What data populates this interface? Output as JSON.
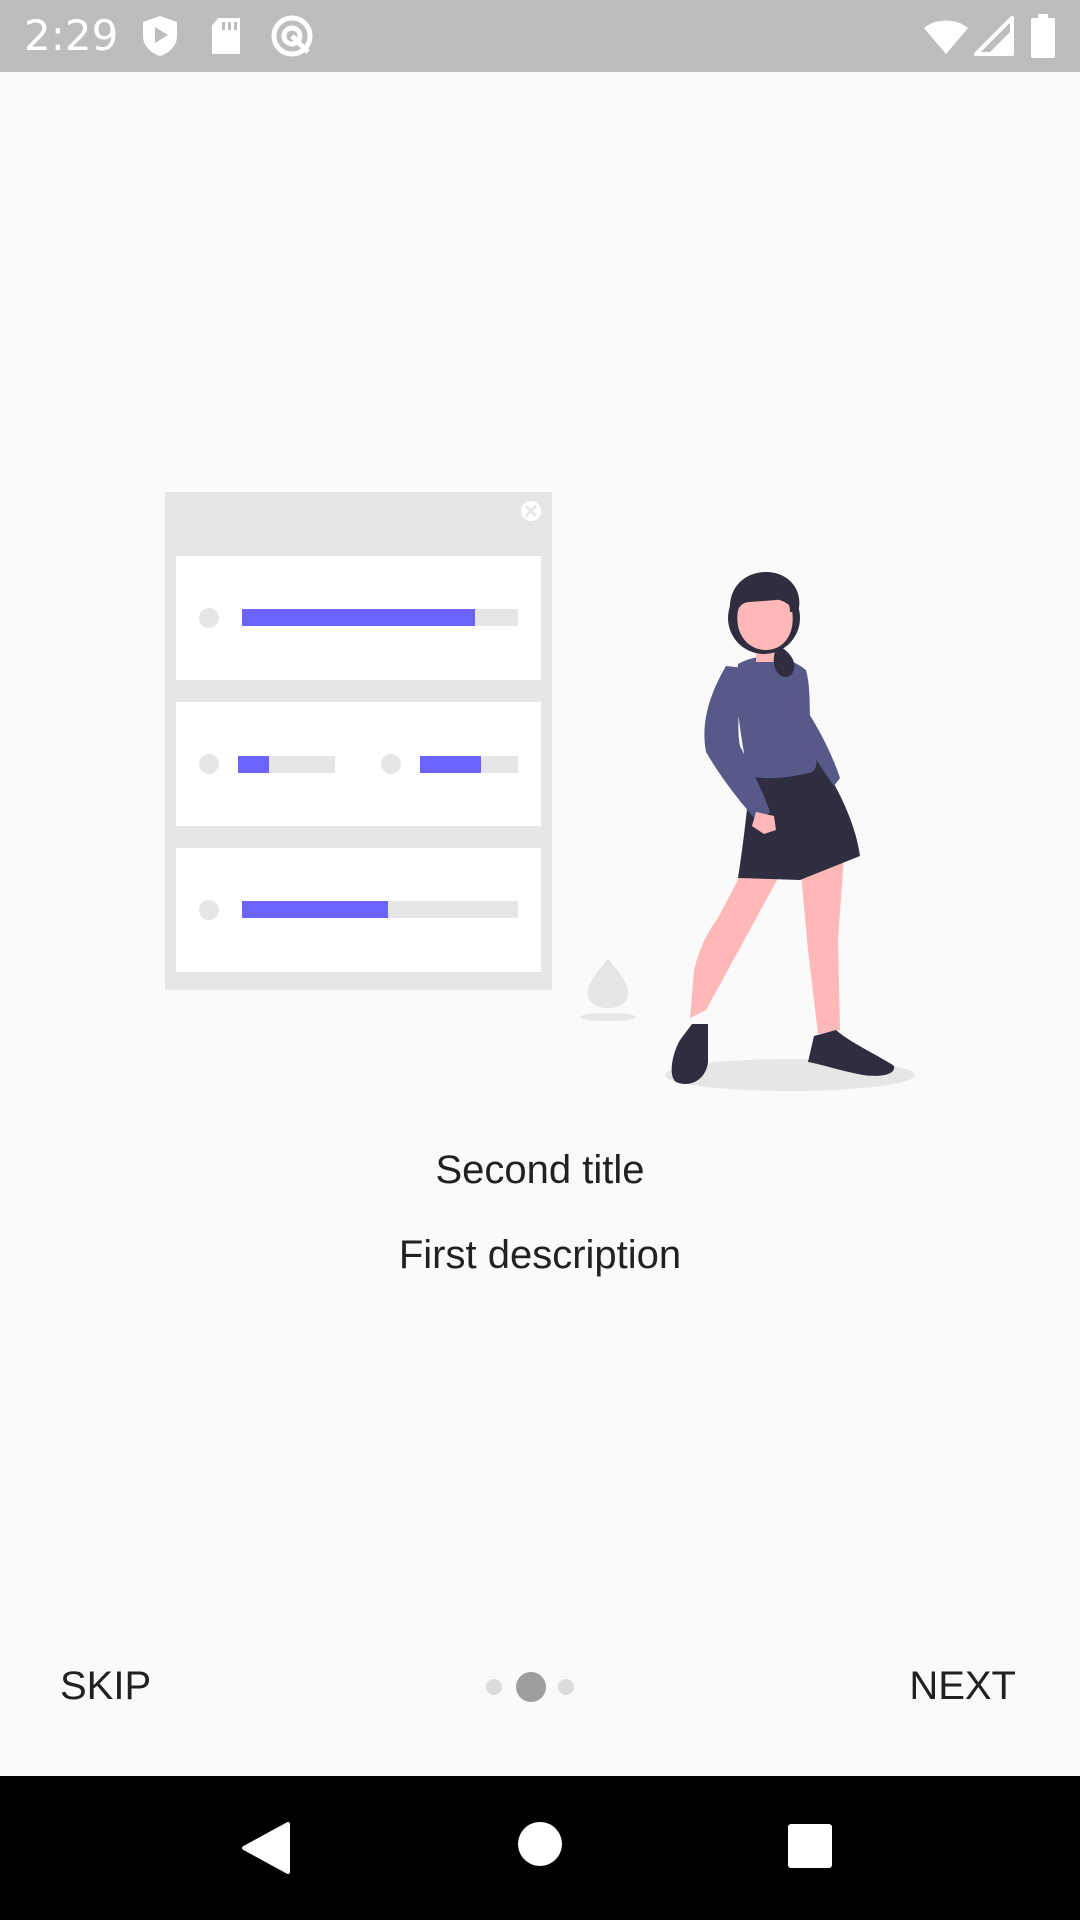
{
  "status_bar": {
    "time": "2:29",
    "left_icons": [
      "shield-play-icon",
      "sd-card-icon",
      "do-not-disturb-icon"
    ],
    "right_icons": [
      "wifi-icon",
      "cellular-signal-icon",
      "battery-icon"
    ],
    "background_color": "#bdbdbd"
  },
  "onboarding": {
    "title": "Second title",
    "description": "First description",
    "illustration": "woman-with-dashboard-illustration",
    "accent_color": "#6c63ff",
    "skin_color": "#ffb8b8",
    "shirt_color": "#575a89",
    "dark_color": "#2f2e41"
  },
  "pager": {
    "page_count": 3,
    "current_page": 2
  },
  "controls": {
    "skip_label": "SKIP",
    "next_label": "NEXT"
  },
  "nav_bar": {
    "buttons": [
      "back-icon",
      "home-icon",
      "recents-icon"
    ]
  }
}
